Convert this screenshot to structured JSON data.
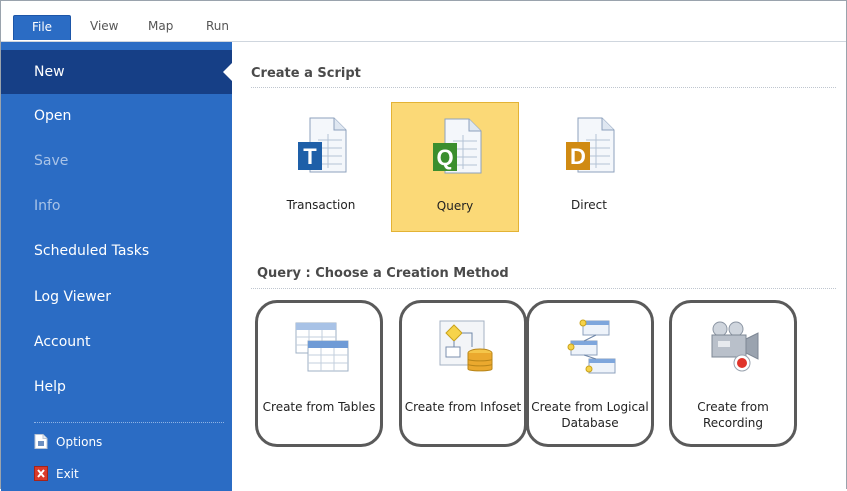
{
  "ribbon": {
    "tabs": [
      {
        "label": "File"
      },
      {
        "label": "View"
      },
      {
        "label": "Map"
      },
      {
        "label": "Run"
      }
    ]
  },
  "sidebar": {
    "items": [
      {
        "label": "New",
        "state": "active"
      },
      {
        "label": "Open",
        "state": "normal"
      },
      {
        "label": "Save",
        "state": "disabled"
      },
      {
        "label": "Info",
        "state": "disabled"
      },
      {
        "label": "Scheduled Tasks",
        "state": "normal"
      },
      {
        "label": "Log Viewer",
        "state": "normal"
      },
      {
        "label": "Account",
        "state": "normal"
      },
      {
        "label": "Help",
        "state": "normal"
      }
    ],
    "options_label": "Options",
    "exit_label": "Exit"
  },
  "create_script": {
    "title": "Create a Script",
    "types": [
      {
        "label": "Transaction",
        "icon": "transaction-script-icon",
        "letter": "T",
        "accent": "#1e5fa8"
      },
      {
        "label": "Query",
        "icon": "query-script-icon",
        "letter": "Q",
        "accent": "#3b8e2e",
        "selected": true
      },
      {
        "label": "Direct",
        "icon": "direct-script-icon",
        "letter": "D",
        "accent": "#d08a12"
      }
    ]
  },
  "creation_method": {
    "title": "Query : Choose a Creation Method",
    "methods": [
      {
        "label": "Create from Tables",
        "icon": "tables-icon"
      },
      {
        "label": "Create from Infoset",
        "icon": "infoset-icon"
      },
      {
        "label": "Create from Logical Database",
        "icon": "logical-database-icon"
      },
      {
        "label": "Create from Recording",
        "icon": "recording-camera-icon"
      }
    ]
  },
  "colors": {
    "brand_blue": "#2b6cc4",
    "active_nav": "#163f86",
    "selected_fill": "#fbd977",
    "highlight_ring": "#5a5a5a"
  }
}
